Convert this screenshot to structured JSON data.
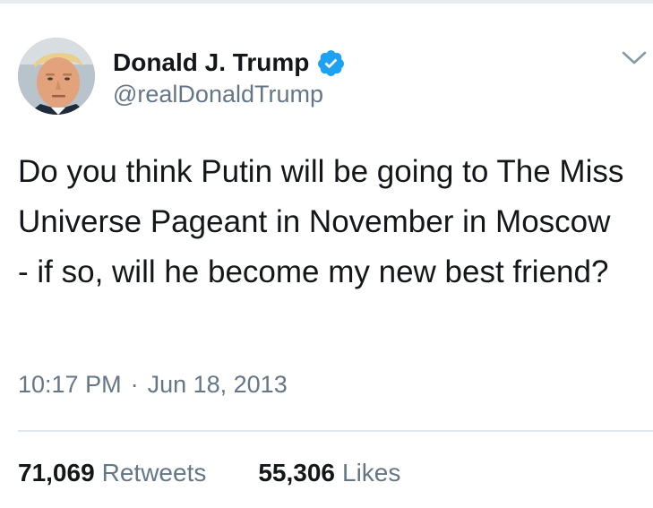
{
  "tweet": {
    "author": {
      "display_name": "Donald J. Trump",
      "handle": "@realDonaldTrump",
      "verified": true,
      "avatar_icon": "profile-photo"
    },
    "text": "Do you think Putin will be going to The Miss Universe Pageant in November in Moscow - if so, will he become my new best friend?",
    "time": "10:17 PM",
    "separator": "·",
    "date": "Jun 18, 2013",
    "stats": {
      "retweets_count": "71,069",
      "retweets_label": "Retweets",
      "likes_count": "55,306",
      "likes_label": "Likes"
    }
  },
  "colors": {
    "text_primary": "#14171a",
    "text_secondary": "#657786",
    "verified_blue": "#1da1f2",
    "divider": "#e1e8ed"
  },
  "icons": {
    "verified": "verified-badge-icon",
    "menu": "chevron-down-icon"
  }
}
